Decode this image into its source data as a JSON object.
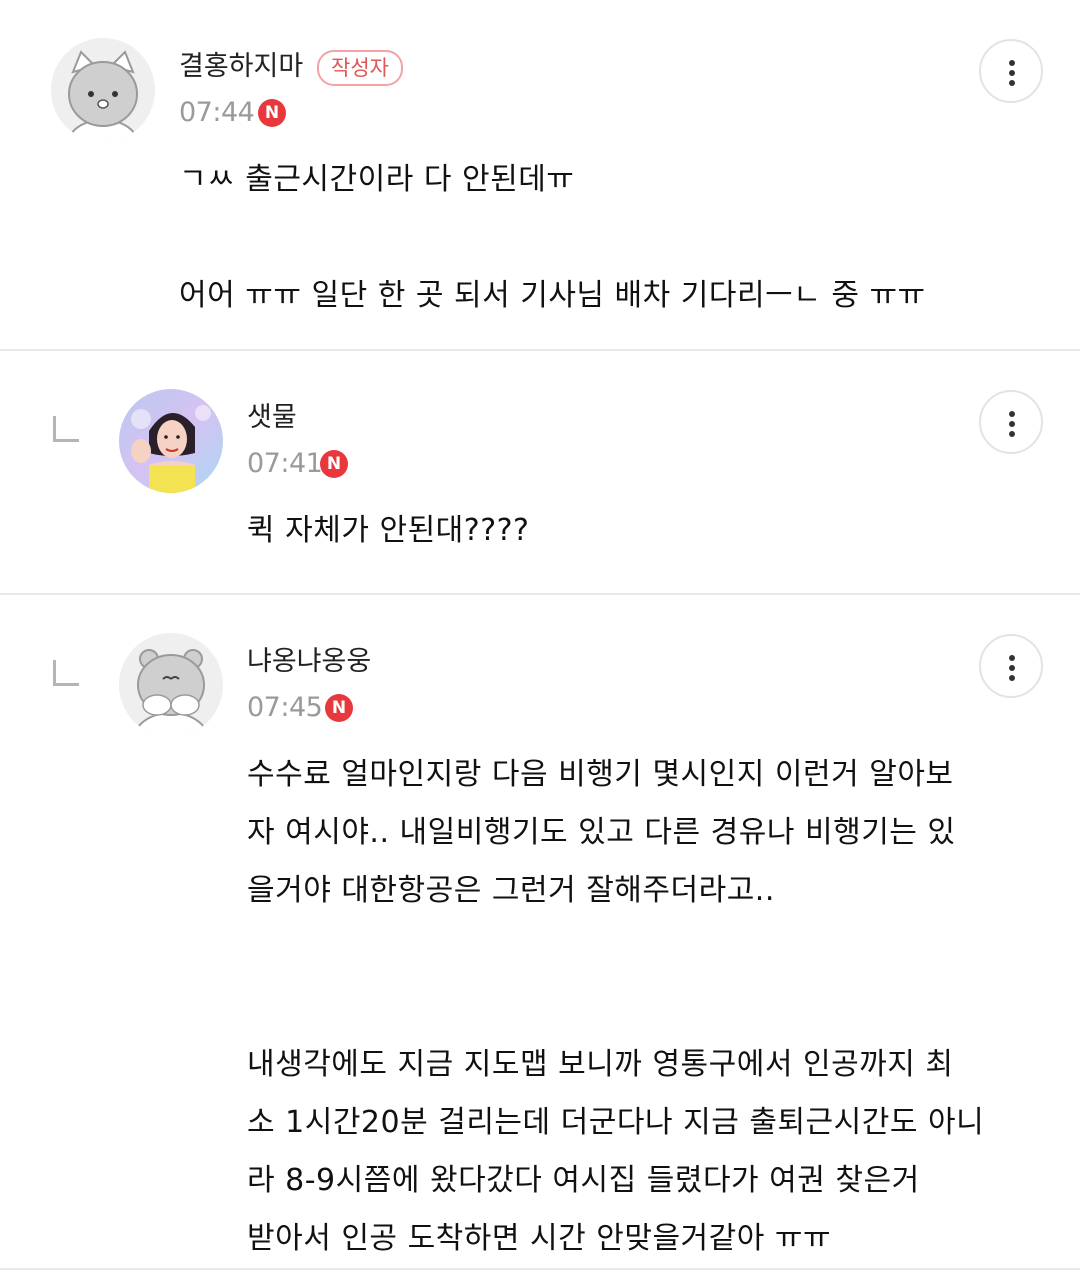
{
  "comments": [
    {
      "author": "결홍하지마",
      "author_badge": "작성자",
      "time": "07:44",
      "new_badge": "N",
      "avatar": "gray-cat-avatar",
      "more_icon": "more-vertical-icon",
      "text": "ㄱㅆ 출근시간이라 다 안된데ㅠ\n\n어어 ㅠㅠ 일단 한 곳 되서 기사님 배차 기다리ㅡㄴ 중 ㅠㅠ"
    },
    {
      "author": "샛물",
      "time": "07:41",
      "new_badge": "N",
      "avatar": "photo-avatar",
      "more_icon": "more-vertical-icon",
      "text": "퀵 자체가 안된대????"
    },
    {
      "author": "냐옹냐옹웅",
      "time": "07:45",
      "new_badge": "N",
      "avatar": "gray-bear-avatar",
      "more_icon": "more-vertical-icon",
      "text": "수수료 얼마인지랑 다음 비행기 몇시인지 이런거 알아보\n자 여시야.. 내일비행기도 있고 다른 경유나 비행기는 있\n을거야 대한항공은 그런거 잘해주더라고..\n\n\n내생각에도 지금 지도맵 보니까 영통구에서 인공까지 최\n소 1시간20분 걸리는데 더군다나 지금 출퇴근시간도 아니\n라 8-9시쯤에 왔다갔다 여시집 들렸다가 여권 찾은거\n받아서 인공 도착하면 시간 안맞을거같아 ㅠㅠ"
    }
  ],
  "colors": {
    "badge_red": "#e8383d",
    "author_badge_text": "#e15656",
    "divider": "#e8e8e8",
    "time_gray": "#9a9a9a"
  }
}
